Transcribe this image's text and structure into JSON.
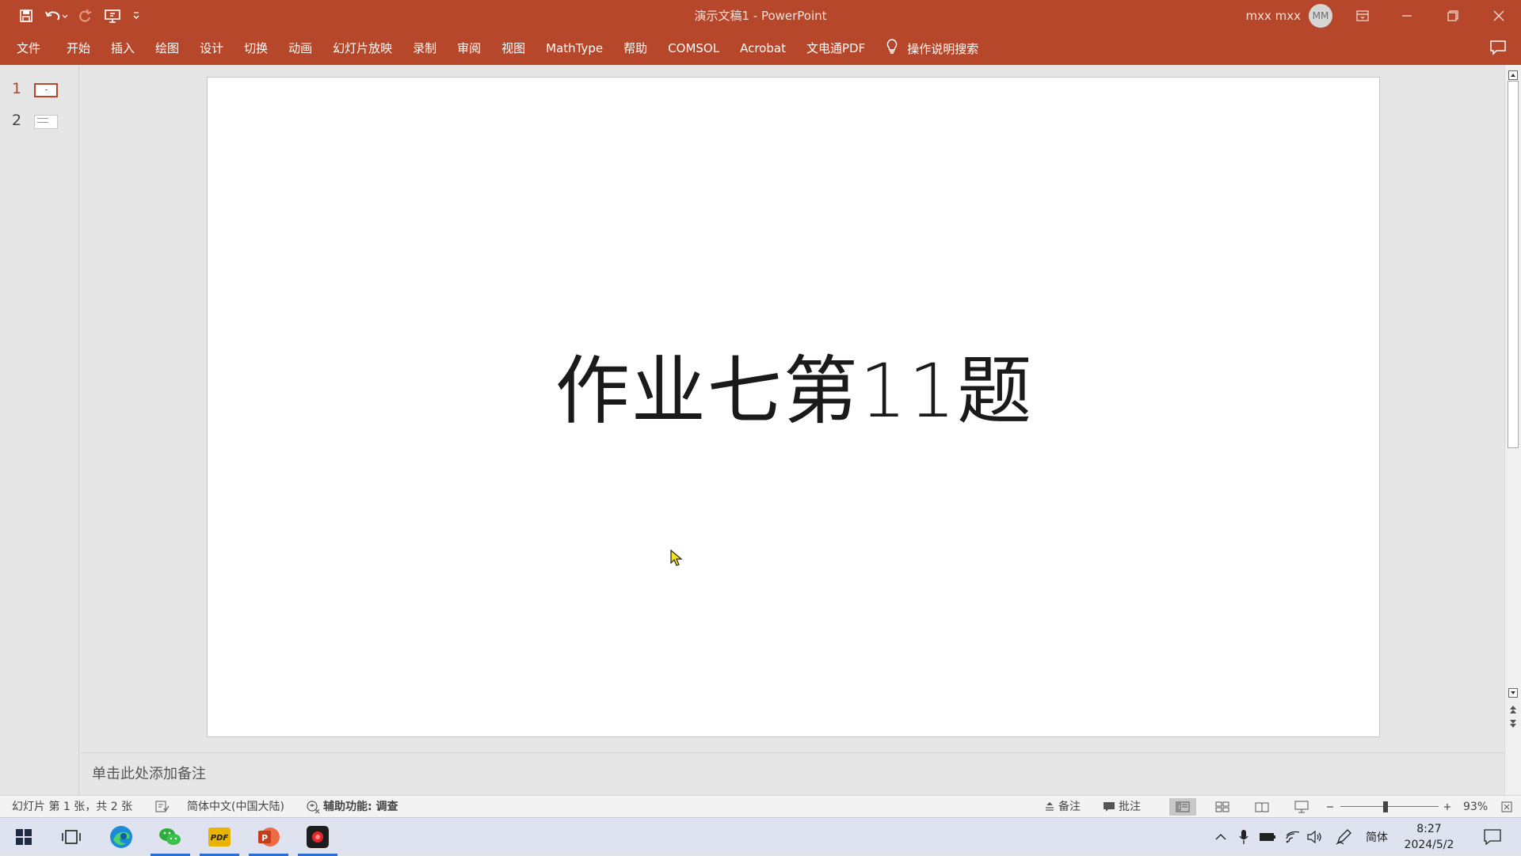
{
  "app": {
    "title": "演示文稿1  -  PowerPoint",
    "user_name": "mxx mxx",
    "user_initials": "MM",
    "accent_color": "#b7472a"
  },
  "quick_access": [
    "save-icon",
    "undo-icon",
    "redo-icon",
    "present-from-start-icon",
    "customize-qat-icon"
  ],
  "ribbon": {
    "tabs": [
      "文件",
      "开始",
      "插入",
      "绘图",
      "设计",
      "切换",
      "动画",
      "幻灯片放映",
      "录制",
      "审阅",
      "视图",
      "MathType",
      "帮助",
      "COMSOL",
      "Acrobat",
      "文电通PDF"
    ],
    "tell_me": "操作说明搜索"
  },
  "thumbnails": [
    {
      "number": "1",
      "selected": true
    },
    {
      "number": "2",
      "selected": false
    }
  ],
  "slide": {
    "title": "作业七第11题"
  },
  "notes": {
    "placeholder": "单击此处添加备注"
  },
  "statusbar": {
    "slide_info": "幻灯片 第 1 张，共 2 张",
    "language": "简体中文(中国大陆)",
    "accessibility": "辅助功能: 调查",
    "notes_label": "备注",
    "comments_label": "批注",
    "zoom": "93%"
  },
  "taskbar": {
    "apps": [
      "windows-start-icon",
      "task-view-icon",
      "edge-icon",
      "wechat-icon",
      "pdf-app-icon",
      "powerpoint-icon",
      "recorder-icon"
    ],
    "ime": "简体",
    "time": "8:27",
    "date": "2024/5/2"
  }
}
